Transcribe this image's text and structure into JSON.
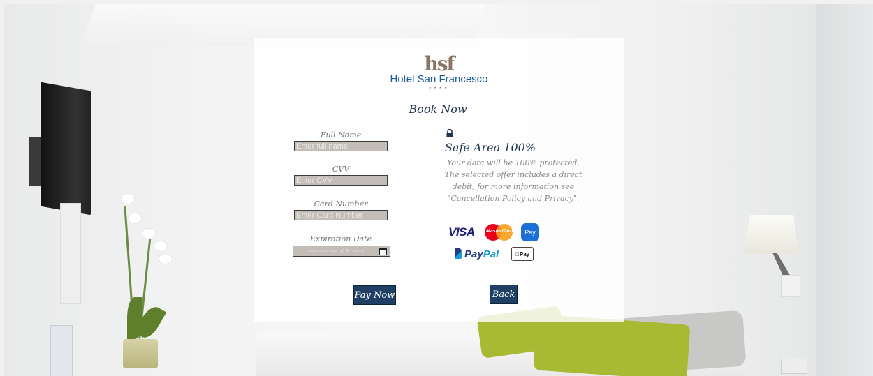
{
  "logo": {
    "mark": "hsf",
    "name": "Hotel San Francesco",
    "stars": "★★★★"
  },
  "header": {
    "title": "Book Now"
  },
  "form": {
    "full_name": {
      "label": "Full Name",
      "placeholder": "Enter full name"
    },
    "cvv": {
      "label": "CVV",
      "placeholder": "Enter CVV"
    },
    "card_number": {
      "label": "Card Number",
      "placeholder": "Enter Card Number"
    },
    "expiration": {
      "label": "Expiration Date",
      "value": "---------- de ----"
    }
  },
  "safe_area": {
    "icon": "lock-icon",
    "title": "Safe Area 100%",
    "text": "Your data will be 100% protected. The selected offer includes a direct debit, for more information see \"Cancellation Policy and Privacy\"."
  },
  "payment_methods": {
    "visa": "VISA",
    "mastercard": "MasterCard",
    "samsung_pay": "Pay",
    "paypal_pay": "Pay",
    "paypal_pal": "Pal",
    "apple_pay": "Pay"
  },
  "buttons": {
    "pay_now": "Pay Now",
    "back": "Back"
  },
  "colors": {
    "button_bg": "#1f4064",
    "input_bg": "#c3bdb7",
    "title_color": "#1f3550",
    "brand_blue": "#1f5a95"
  }
}
